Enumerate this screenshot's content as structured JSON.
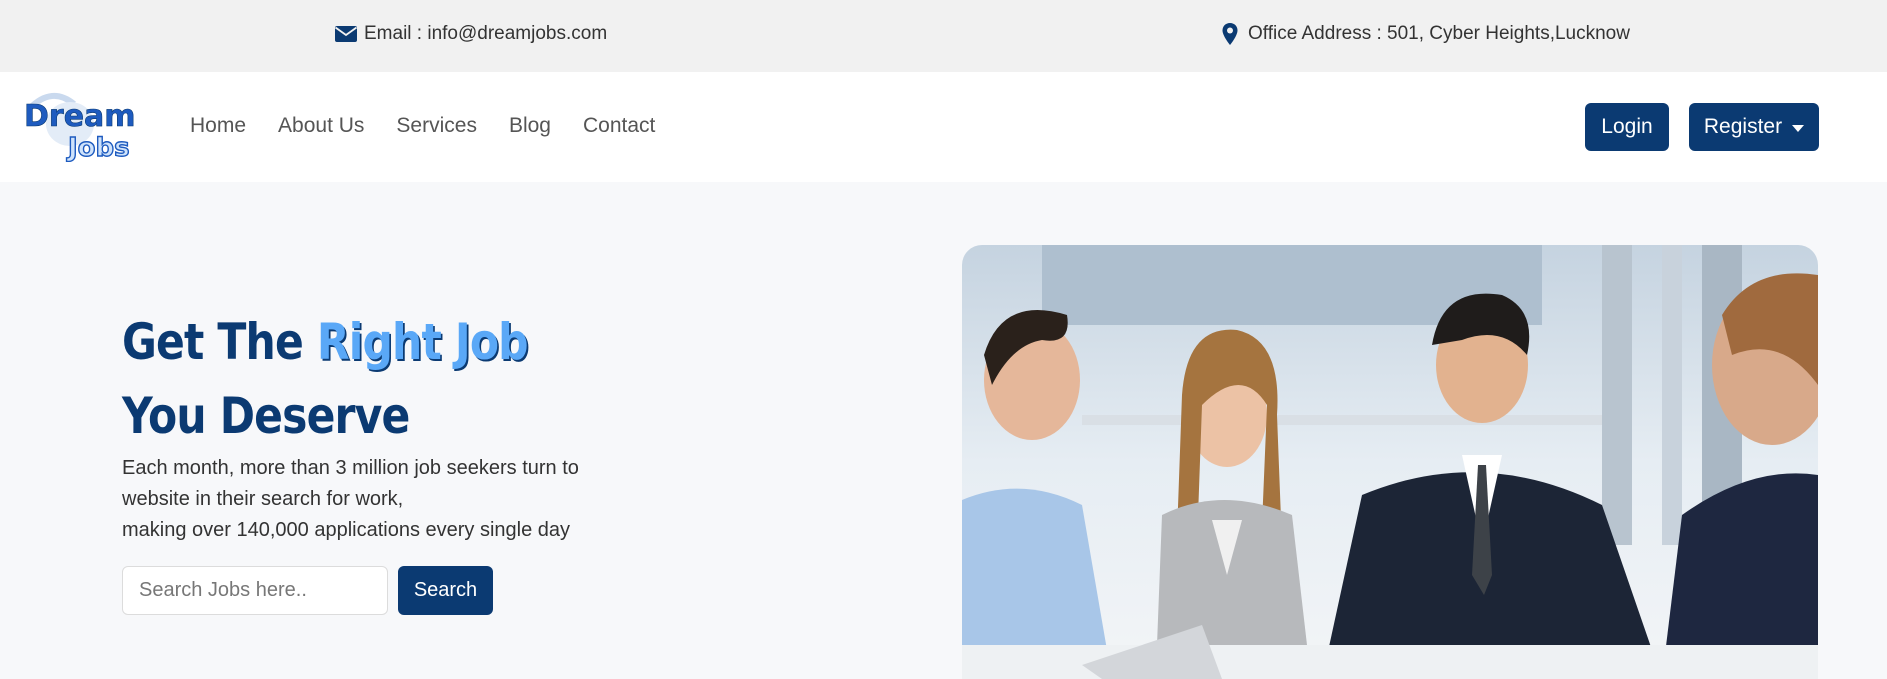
{
  "topbar": {
    "email": {
      "icon": "envelope-icon",
      "text": "Email : info@dreamjobs.com"
    },
    "address": {
      "icon": "map-pin-icon",
      "text": "Office Address : 501, Cyber Heights,Lucknow"
    }
  },
  "brand": {
    "logo_top": "Dream",
    "logo_bottom": "Jobs"
  },
  "nav": {
    "links": [
      "Home",
      "About Us",
      "Services",
      "Blog",
      "Contact"
    ],
    "login_label": "Login",
    "register_label": "Register"
  },
  "hero": {
    "title_part1": "Get The ",
    "title_accent": "Right Job",
    "title_line2": "You Deserve",
    "description_line1": "Each month, more than 3 million job seekers turn to",
    "description_line2": "website in their search for work,",
    "description_line3": "making over 140,000 applications every single day",
    "search_placeholder": "Search Jobs here..",
    "search_value": "",
    "search_button": "Search"
  },
  "colors": {
    "primary": "#0b3a72",
    "accent": "#5aa8f7",
    "topbar_bg": "#f1f1f1",
    "page_bg": "#f7f8fa"
  }
}
